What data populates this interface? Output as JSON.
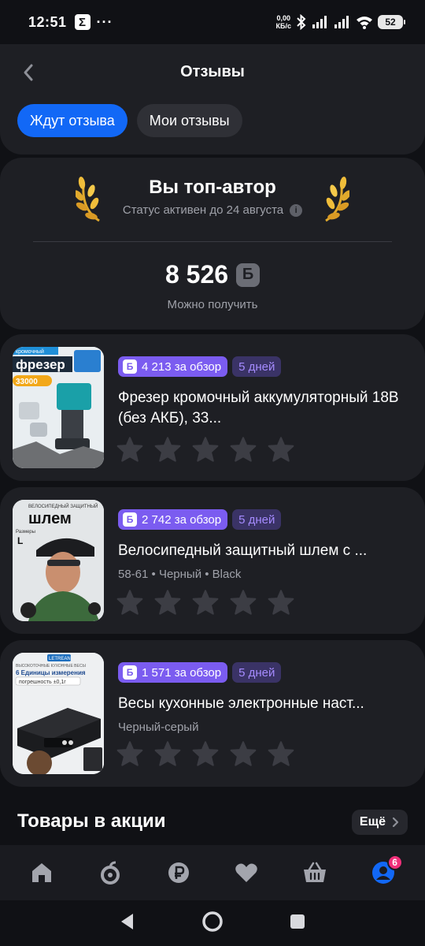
{
  "status_bar": {
    "time": "12:51",
    "network_speed_value": "0,00",
    "network_speed_unit": "КБ/с",
    "battery": "52"
  },
  "header": {
    "title": "Отзывы",
    "tabs": [
      {
        "label": "Ждут отзыва",
        "active": true
      },
      {
        "label": "Мои отзывы",
        "active": false
      }
    ]
  },
  "top_author": {
    "title": "Вы топ-автор",
    "status": "Статус активен до 24 августа",
    "points": "8 526",
    "currency_symbol": "Б",
    "points_label": "Можно получить"
  },
  "products": [
    {
      "bonus": "4 213 за обзор",
      "days": "5 дней",
      "name": "Фрезер кромочный аккумуляторный 18В (без АКБ), 33...",
      "variant": "",
      "rating": 0,
      "thumb_text": [
        "кромочный",
        "фрезер",
        "33000"
      ]
    },
    {
      "bonus": "2 742 за обзор",
      "days": "5 дней",
      "name": "Велосипедный защитный шлем с ...",
      "variant": "58-61 • Черный • Black",
      "rating": 0,
      "thumb_text": [
        "ВЕЛОСИПЕДНЫЙ ЗАЩИТНЫЙ",
        "шлем",
        "Размеры",
        "L"
      ]
    },
    {
      "bonus": "1 571 за обзор",
      "days": "5 дней",
      "name": "Весы кухонные электронные наст...",
      "variant": "Черный-серый",
      "rating": 0,
      "thumb_text": [
        "LETREAN",
        "ВЫСОКОТОЧНЫЕ КУХОННЫЕ ВЕСЫ",
        "6 Единицы измерения",
        "погрешность ±0,1г"
      ]
    }
  ],
  "promo": {
    "title": "Товары в акции",
    "more_label": "Ещё"
  },
  "bottom_nav": {
    "items": [
      "home-icon",
      "catalog-icon",
      "ruble-icon",
      "heart-icon",
      "basket-icon",
      "profile-icon"
    ],
    "profile_badge": "6",
    "accent": "#1268f6"
  },
  "colors": {
    "background": "#101115",
    "card": "#1e1f24",
    "accent_blue": "#1268f6",
    "bonus_purple": "#7b5cf0",
    "gold": "#e0a92c"
  }
}
